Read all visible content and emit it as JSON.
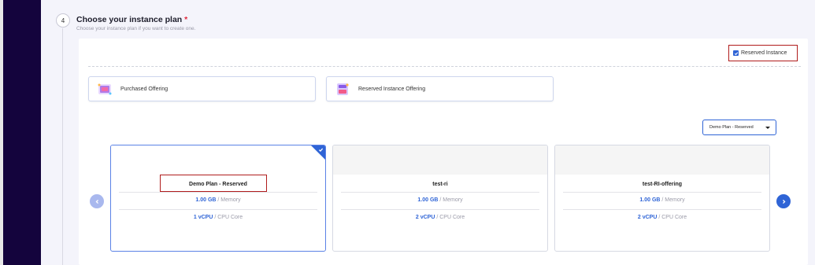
{
  "step": {
    "number": "4",
    "title": "Choose your instance plan",
    "required_mark": "*",
    "subtitle": "Choose your instance plan if you want to create one."
  },
  "reserved_instance_checkbox": {
    "label": "Reserved Instance",
    "checked": true
  },
  "offering_tabs": [
    {
      "label": "Purchased Offering",
      "icon": "purchased-offering-icon"
    },
    {
      "label": "Reserved Instance Offering",
      "icon": "reserved-offering-icon"
    }
  ],
  "plan_select": {
    "selected": "Demo Plan - Reserved"
  },
  "plans": [
    {
      "name": "Demo Plan - Reserved",
      "memory_value": "1.00 GB",
      "memory_unit": "/ Memory",
      "cpu_value": "1 vCPU",
      "cpu_unit": "/ CPU Core",
      "selected": true
    },
    {
      "name": "test-ri",
      "memory_value": "1.00 GB",
      "memory_unit": "/ Memory",
      "cpu_value": "2 vCPU",
      "cpu_unit": "/ CPU Core",
      "selected": false
    },
    {
      "name": "test-RI-offering",
      "memory_value": "1.00 GB",
      "memory_unit": "/ Memory",
      "cpu_value": "2 vCPU",
      "cpu_unit": "/ CPU Core",
      "selected": false
    }
  ],
  "colors": {
    "accent": "#2f64d6",
    "sidebar": "#14043d",
    "highlight_border": "#b01c1c"
  }
}
